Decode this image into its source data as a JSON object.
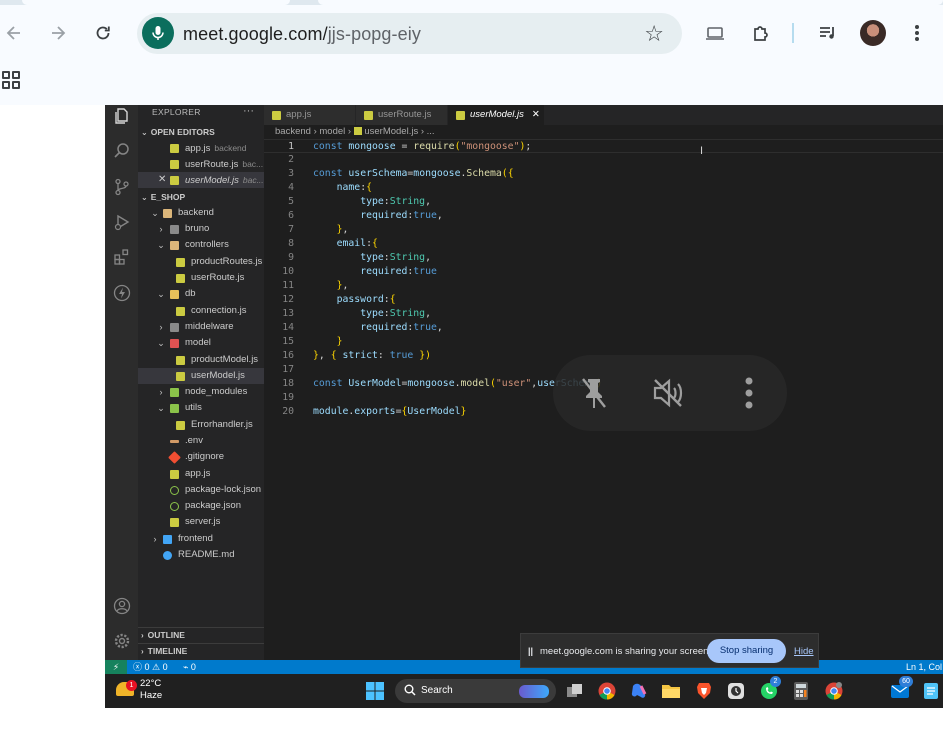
{
  "browser": {
    "url_host": "meet.google.com/",
    "url_path": "jjs-popg-eiy",
    "nav": {
      "back": "back-icon",
      "forward": "forward-icon",
      "reload": "reload-icon"
    },
    "icons": [
      "mic-icon",
      "star-icon",
      "cast-icon",
      "extensions-icon",
      "media-icon",
      "avatar",
      "menu-icon",
      "apps-icon"
    ]
  },
  "vscode": {
    "explorer_header": "EXPLORER",
    "explorer_more": "···",
    "open_editors_label": "OPEN EDITORS",
    "open_editors": [
      {
        "name": "app.js",
        "desc": "backend",
        "closeable": false
      },
      {
        "name": "userRoute.js",
        "desc": "bac...",
        "closeable": false
      },
      {
        "name": "userModel.js",
        "desc": "bac...",
        "closeable": true
      }
    ],
    "workspace_label": "E_SHOP",
    "tree": [
      {
        "label": "backend",
        "kind": "folder-open"
      },
      {
        "label": "bruno",
        "kind": "folder"
      },
      {
        "label": "controllers",
        "kind": "folder-open"
      },
      {
        "label": "productRoutes.js",
        "kind": "js"
      },
      {
        "label": "userRoute.js",
        "kind": "js"
      },
      {
        "label": "db",
        "kind": "folder-open"
      },
      {
        "label": "connection.js",
        "kind": "js"
      },
      {
        "label": "middelware",
        "kind": "folder"
      },
      {
        "label": "model",
        "kind": "folder-open"
      },
      {
        "label": "productModel.js",
        "kind": "js"
      },
      {
        "label": "userModel.js",
        "kind": "js"
      },
      {
        "label": "node_modules",
        "kind": "folder"
      },
      {
        "label": "utils",
        "kind": "folder-open"
      },
      {
        "label": "Errorhandler.js",
        "kind": "js"
      },
      {
        "label": ".env",
        "kind": "env"
      },
      {
        "label": ".gitignore",
        "kind": "git"
      },
      {
        "label": "app.js",
        "kind": "js"
      },
      {
        "label": "package-lock.json",
        "kind": "json"
      },
      {
        "label": "package.json",
        "kind": "json"
      },
      {
        "label": "server.js",
        "kind": "js"
      },
      {
        "label": "frontend",
        "kind": "folder"
      },
      {
        "label": "README.md",
        "kind": "info"
      }
    ],
    "outline_label": "OUTLINE",
    "timeline_label": "TIMELINE",
    "tabs": [
      {
        "label": "app.js",
        "active": false
      },
      {
        "label": "userRoute.js",
        "active": false
      },
      {
        "label": "userModel.js",
        "active": true,
        "close": "✕"
      }
    ],
    "breadcrumb": {
      "part1": "backend",
      "part2": "model",
      "part3": "userModel.js",
      "part4": "...",
      "sep": "›"
    },
    "code_lines": [
      "const mongoose = require(\"mongoose\");",
      "",
      "const userSchema=mongoose.Schema({",
      "    name:{",
      "        type:String,",
      "        required:true,",
      "    },",
      "    email:{",
      "        type:String,",
      "        required:true",
      "    },",
      "    password:{",
      "        type:String,",
      "        required:true,",
      "    }",
      "}, { strict: true })",
      "",
      "const UserModel=mongoose.model(\"user\",userSchema)",
      "",
      "module.exports={UserModel}"
    ],
    "line_numbers": [
      "1",
      "2",
      "3",
      "4",
      "5",
      "6",
      "7",
      "8",
      "9",
      "10",
      "11",
      "12",
      "13",
      "14",
      "15",
      "16",
      "17",
      "18",
      "19",
      "20"
    ],
    "status": {
      "errors": "0",
      "warnings": "0",
      "ports": "0",
      "position": "Ln 1, Col"
    }
  },
  "meet": {
    "controls": [
      "unpin-icon",
      "mute-icon",
      "more-vert-icon"
    ],
    "share_message": "meet.google.com is sharing your screen.",
    "stop_label": "Stop sharing",
    "hide_label": "Hide"
  },
  "taskbar": {
    "temperature": "22°C",
    "condition": "Haze",
    "weather_badge": "1",
    "search_label": "Search",
    "whatsapp_badge": "2",
    "mail_badge": "60"
  }
}
